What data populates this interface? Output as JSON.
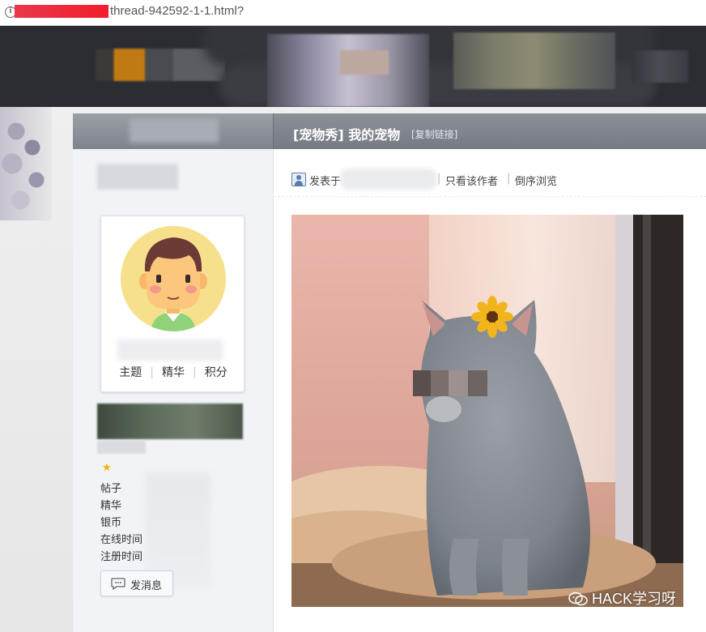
{
  "address_bar": {
    "url": "thread-942592-1-1.html?"
  },
  "thread": {
    "title": "[宠物秀] 我的宠物",
    "copy_link": "[复制链接]"
  },
  "post_meta": {
    "posted_label": "发表于",
    "separator": "|",
    "only_author": "只看该作者",
    "reverse_order": "倒序浏览"
  },
  "profile": {
    "stats": [
      "主题",
      "精华",
      "积分"
    ],
    "info_labels": [
      "帖子",
      "精华",
      "银币",
      "在线时间",
      "注册时间"
    ],
    "message_button": "发消息"
  },
  "photo": {
    "watermark": "HACK学习呀"
  },
  "colors": {
    "header": "#7f848c",
    "banner": "#2b2d33",
    "sidebar": "#f1f3f7"
  }
}
